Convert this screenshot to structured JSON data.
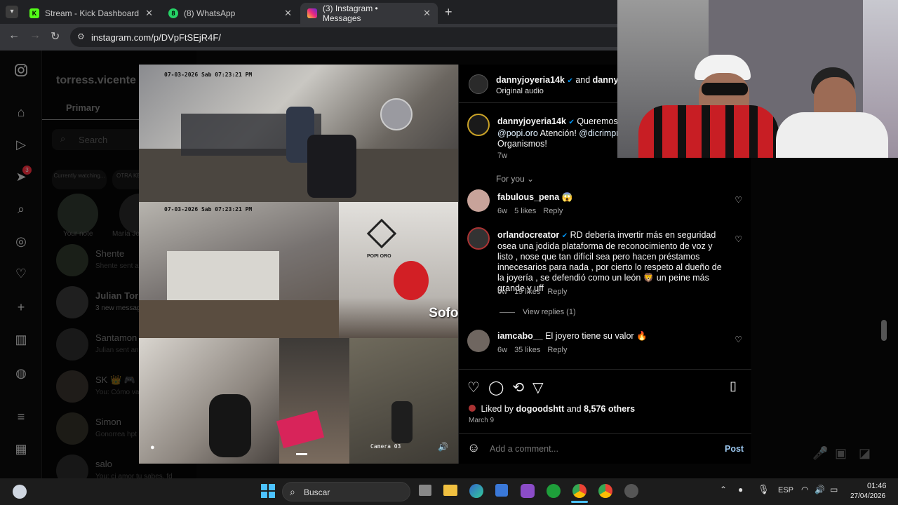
{
  "browser": {
    "tabs": [
      {
        "title": "Stream - Kick Dashboard",
        "favicon_text": "K",
        "favicon_color": "#53fc18"
      },
      {
        "title": "(8) WhatsApp",
        "favicon_text": "8",
        "favicon_color": "#25d366"
      },
      {
        "title": "(3) Instagram • Messages",
        "favicon_text": "",
        "favicon_color": "#e1306c"
      }
    ],
    "new_tab": "+",
    "close": "✕",
    "url": "instagram.com/p/DVpFtSEjR4F/"
  },
  "dm": {
    "username": "torress.vicente",
    "tab_primary": "Primary",
    "search_placeholder": "Search",
    "notes": [
      {
        "label": "Your note",
        "top": "Currently watching..."
      },
      {
        "label": "María Jo",
        "top": "OTRA KEVIN"
      }
    ],
    "conversations": [
      {
        "name": "Shente",
        "preview": "Shente sent a"
      },
      {
        "name": "Julian Torre",
        "preview": "3 new messag"
      },
      {
        "name": "Santamon",
        "preview": "Julian sent an"
      },
      {
        "name": "SK 👑 🎮",
        "preview": "You: Cómo va"
      },
      {
        "name": "Simon",
        "preview": "Gonorrea hpt"
      },
      {
        "name": "salo",
        "preview": "You: ci amor tu sabes, fd"
      }
    ],
    "badge": "3"
  },
  "media": {
    "timestamp1": "07-03-2026 Sab 07:23:21 PM",
    "timestamp2": "07-03-2026 Sab 07:23:21 PM",
    "camera_label": "Camera 03",
    "watermark": "Sofokando.",
    "store_sign": "POPI ORO"
  },
  "post": {
    "author": "dannyjoyeria14k",
    "and": "and",
    "coauthor": "dannyjoy",
    "audio": "Original audio",
    "caption_line1": "Queremos re",
    "caption_mention1": "@popi.oro",
    "caption_mid": "Atención!",
    "caption_mention2": "@dicrimpnn",
    "caption_end": "Organismos!",
    "caption_time": "7w",
    "for_you": "For you",
    "comments": [
      {
        "user": "fabulous_pena",
        "text": "😱",
        "time": "6w",
        "likes": "5 likes",
        "reply": "Reply"
      },
      {
        "user": "orlandocreator",
        "text": "RD debería invertir más en seguridad osea una jodida plataforma de reconocimiento de voz y listo , nose que tan difícil sea pero hacen préstamos innecesarios para nada , por cierto lo respeto al dueño de la joyería , se defendió como un león 🦁 un peine más grande y uff",
        "time": "6w",
        "likes": "19 likes",
        "reply": "Reply"
      },
      {
        "user": "iamcabo__",
        "text": "El joyero tiene su valor 🔥",
        "time": "6w",
        "likes": "35 likes",
        "reply": "Reply"
      }
    ],
    "view_replies": "View replies (1)",
    "liked_prefix": "Liked by",
    "liked_user": "dogoodshtt",
    "liked_and": "and",
    "liked_count": "8,576 others",
    "date": "March 9",
    "add_comment_placeholder": "Add a comment...",
    "post_button": "Post"
  },
  "taskbar": {
    "search": "Buscar",
    "lang": "ESP",
    "time": "01:46",
    "date": "27/04/2026"
  }
}
